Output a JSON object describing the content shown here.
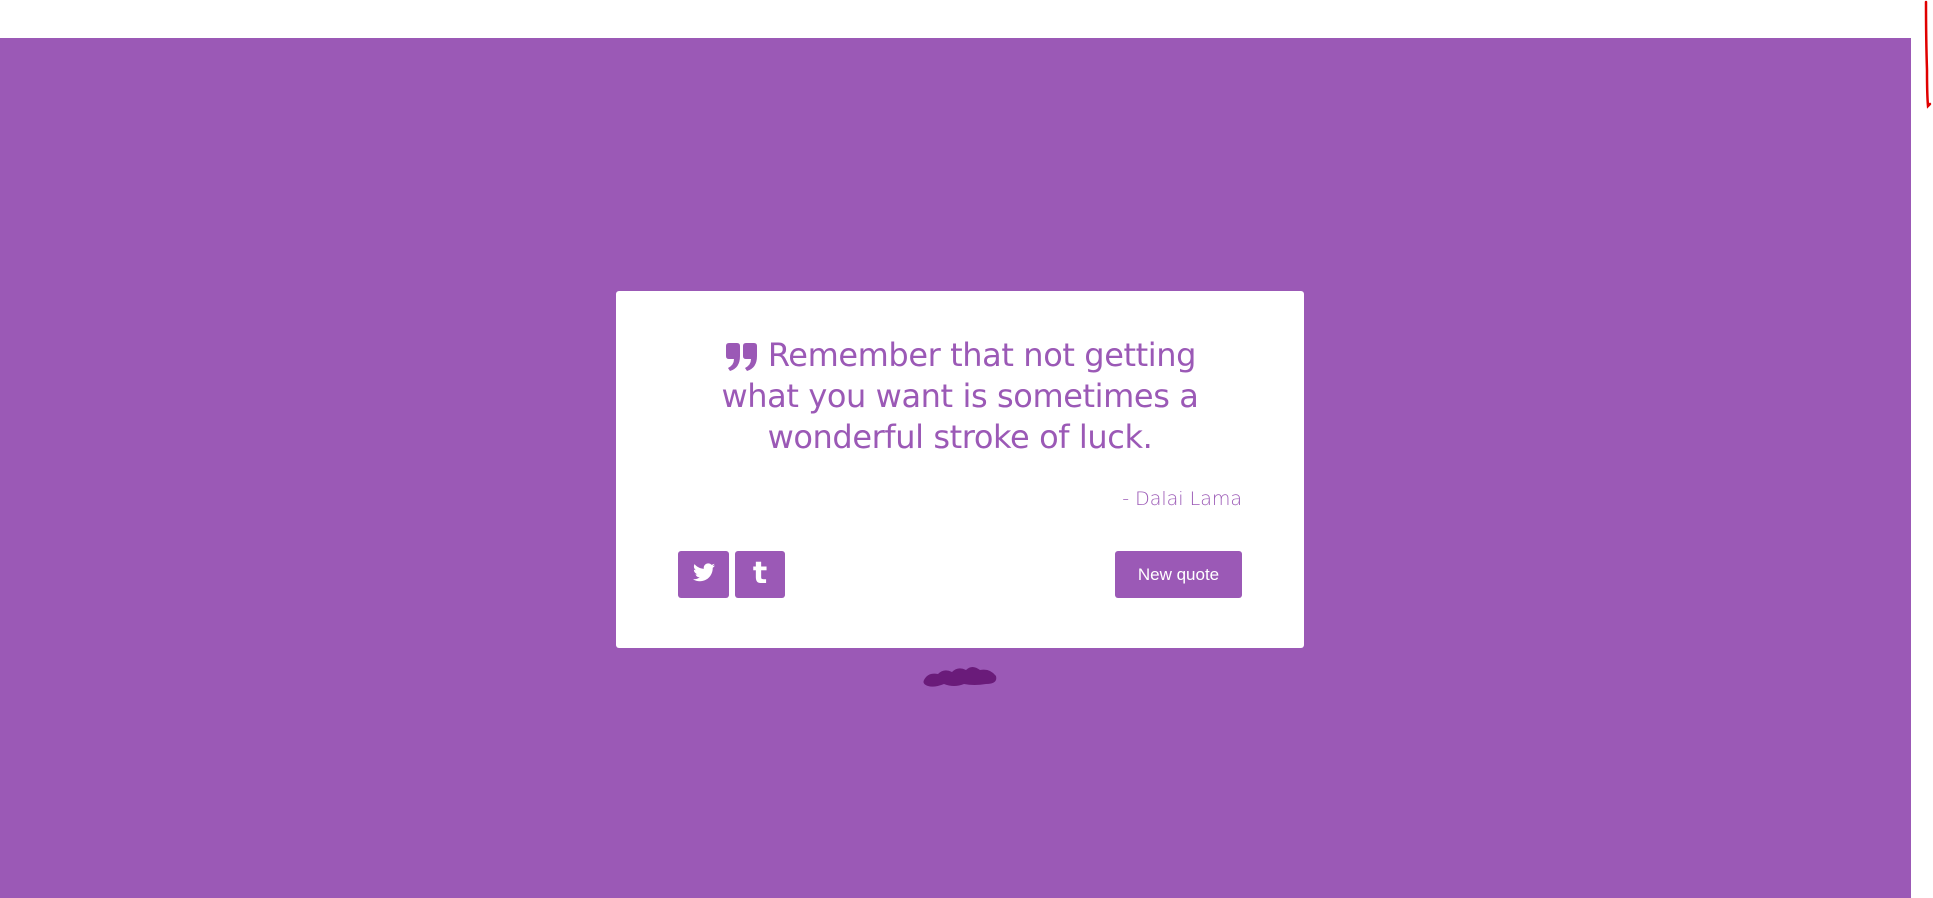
{
  "page": {
    "background_color": "#9b59b6",
    "accent_color": "#9b59b6",
    "card_color": "#ffffff"
  },
  "quote": {
    "icon": "quote-left-icon",
    "text": "Remember that not getting what you want is sometimes a wonderful stroke of luck.",
    "author": "- Dalai Lama"
  },
  "actions": {
    "twitter_icon": "twitter-icon",
    "tumblr_icon": "tumblr-icon",
    "tumblr_glyph": "t",
    "new_quote_label": "New quote"
  }
}
